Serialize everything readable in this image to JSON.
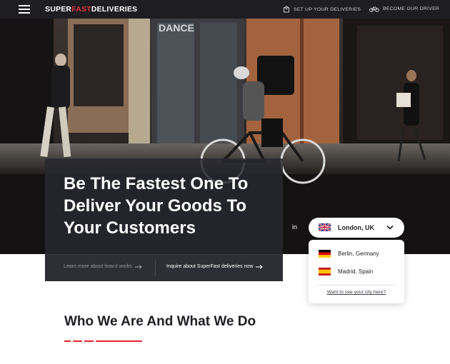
{
  "header": {
    "logo_part1": "SUPER",
    "logo_part2": "FAST",
    "logo_part3": "DELIVERIES",
    "menu_icon": "hamburger-menu-icon",
    "nav": [
      {
        "label": "SET UP YOUR DELIVERIES",
        "icon": "package-icon"
      },
      {
        "label": "BECOME OUR DRIVER",
        "icon": "bicycle-icon"
      }
    ]
  },
  "hero": {
    "image": "photo of courier on bicycle in city street",
    "headline": "Be The Fastest One To Deliver Your Goods To Your Customers",
    "links": [
      {
        "label": "Learn more about how it works",
        "icon": "arrow-right-icon"
      },
      {
        "label": "Inquire about SuperFast deliveries now",
        "icon": "arrow-right-icon"
      }
    ]
  },
  "city_selector": {
    "prefix": "in",
    "selected": "London, UK",
    "options": [
      {
        "label": "Berlin, Germany",
        "flag": "germany-flag-icon"
      },
      {
        "label": "Madrid, Spain",
        "flag": "spain-flag-icon"
      }
    ],
    "footer_link": "Want to see your city here?"
  },
  "section": {
    "title": "Who We Are And What We Do"
  },
  "colors": {
    "accent": "#e2262e",
    "header_bg": "#1d1d22",
    "card_bg": "#2e2e36"
  }
}
